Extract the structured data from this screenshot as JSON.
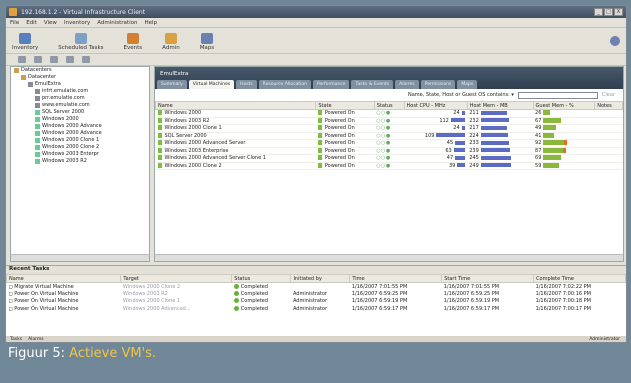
{
  "window": {
    "title": "192.168.1.2 - Virtual Infrastructure Client",
    "buttons": [
      "_",
      "□",
      "X"
    ]
  },
  "menu": [
    "File",
    "Edit",
    "View",
    "Inventory",
    "Administration",
    "Help"
  ],
  "toolbar": {
    "buttons": [
      {
        "label": "Inventory",
        "icon": "inventory-icon",
        "color": "#5a7fbf"
      },
      {
        "label": "Scheduled Tasks",
        "icon": "scheduled-tasks-icon",
        "color": "#7ca0c8"
      },
      {
        "label": "Events",
        "icon": "events-icon",
        "color": "#d08030"
      },
      {
        "label": "Admin",
        "icon": "admin-icon",
        "color": "#d8a040"
      },
      {
        "label": "Maps",
        "icon": "maps-icon",
        "color": "#6a80b0"
      }
    ]
  },
  "tree": [
    {
      "label": "Datacenters",
      "level": 0,
      "kind": "dc"
    },
    {
      "label": "Datacenter",
      "level": 1,
      "kind": "dc"
    },
    {
      "label": "EmulExtra",
      "level": 2,
      "kind": "host"
    },
    {
      "label": "infrt.emulatie.com",
      "level": 3,
      "kind": "host"
    },
    {
      "label": "prr.emulatie.com",
      "level": 3,
      "kind": "host"
    },
    {
      "label": "www.emulatie.com",
      "level": 3,
      "kind": "host"
    },
    {
      "label": "SQL Server 2000",
      "level": 3,
      "kind": "vm"
    },
    {
      "label": "Windows 2000",
      "level": 3,
      "kind": "vm"
    },
    {
      "label": "Windows 2000 Advance",
      "level": 3,
      "kind": "vm"
    },
    {
      "label": "Windows 2000 Advance",
      "level": 3,
      "kind": "vm"
    },
    {
      "label": "Windows 2000 Clone 1",
      "level": 3,
      "kind": "vm"
    },
    {
      "label": "Windows 2000 Clone 2",
      "level": 3,
      "kind": "vm"
    },
    {
      "label": "Windows 2003 Enterpr",
      "level": 3,
      "kind": "vm"
    },
    {
      "label": "Windows 2003 R2",
      "level": 3,
      "kind": "vm"
    }
  ],
  "main": {
    "title": "EmulExtra",
    "tabs": [
      "Summary",
      "Virtual Machines",
      "Hosts",
      "Resource Allocation",
      "Performance",
      "Tasks & Events",
      "Alarms",
      "Permissions",
      "Maps"
    ],
    "active_tab": 1,
    "filter_label": "Name, State, Host or Guest OS contains: ▾",
    "filter_clear": "Clear",
    "columns": [
      "Name",
      "State",
      "Status",
      "Host CPU - MHz",
      "Host Mem - MB",
      "Guest Mem - %",
      "Notes"
    ],
    "rows": [
      {
        "name": "Windows 2000",
        "state": "Powered On",
        "status": "○○●",
        "cpu": "24",
        "cpu_frac": 0.1,
        "mem": "211",
        "mem_frac": 0.72,
        "guest": "26",
        "guest_frac": 0.26
      },
      {
        "name": "Windows 2003 R2",
        "state": "Powered On",
        "status": "○○●",
        "cpu": "112",
        "cpu_frac": 0.4,
        "mem": "232",
        "mem_frac": 0.78,
        "guest": "67",
        "guest_frac": 0.67
      },
      {
        "name": "Windows 2000 Clone 1",
        "state": "Powered On",
        "status": "○○●",
        "cpu": "24",
        "cpu_frac": 0.1,
        "mem": "217",
        "mem_frac": 0.74,
        "guest": "49",
        "guest_frac": 0.49
      },
      {
        "name": "SQL Server 2000",
        "state": "Powered On",
        "status": "○○●",
        "cpu": "109",
        "cpu_frac": 0.8,
        "mem": "224",
        "mem_frac": 0.76,
        "guest": "41",
        "guest_frac": 0.41
      },
      {
        "name": "Windows 2000 Advanced Server",
        "state": "Powered On",
        "status": "○○●",
        "cpu": "45",
        "cpu_frac": 0.28,
        "mem": "233",
        "mem_frac": 0.79,
        "guest": "92",
        "guest_frac": 0.92
      },
      {
        "name": "Windows 2003 Enterprise",
        "state": "Powered On",
        "status": "○○●",
        "cpu": "63",
        "cpu_frac": 0.32,
        "mem": "239",
        "mem_frac": 0.81,
        "guest": "87",
        "guest_frac": 0.87
      },
      {
        "name": "Windows 2000 Advanced Server Clone 1",
        "state": "Powered On",
        "status": "○○●",
        "cpu": "47",
        "cpu_frac": 0.28,
        "mem": "245",
        "mem_frac": 0.83,
        "guest": "69",
        "guest_frac": 0.69
      },
      {
        "name": "Windows 2000 Clone 2",
        "state": "Powered On",
        "status": "○○●",
        "cpu": "39",
        "cpu_frac": 0.22,
        "mem": "249",
        "mem_frac": 0.85,
        "guest": "59",
        "guest_frac": 0.59
      }
    ]
  },
  "recent": {
    "title": "Recent Tasks",
    "columns": [
      "Name",
      "Target",
      "Status",
      "Initiated by",
      "Time",
      "Start Time",
      "Complete Time"
    ],
    "rows": [
      {
        "name": "Migrate Virtual Machine",
        "target": "Windows 2000 Clone 2",
        "status": "Completed",
        "by": "",
        "time": "1/16/2007 7:01:55 PM",
        "start": "1/16/2007 7:01:55 PM",
        "complete": "1/16/2007 7:02:22 PM"
      },
      {
        "name": "Power On Virtual Machine",
        "target": "Windows 2003 R2",
        "status": "Completed",
        "by": "Administrator",
        "time": "1/16/2007 6:59:25 PM",
        "start": "1/16/2007 6:59:25 PM",
        "complete": "1/16/2007 7:00:16 PM"
      },
      {
        "name": "Power On Virtual Machine",
        "target": "Windows 2000 Clone 1",
        "status": "Completed",
        "by": "Administrator",
        "time": "1/16/2007 6:59:19 PM",
        "start": "1/16/2007 6:59:19 PM",
        "complete": "1/16/2007 7:00:18 PM"
      },
      {
        "name": "Power On Virtual Machine",
        "target": "Windows 2000 Advanced...",
        "status": "Completed",
        "by": "Administrator",
        "time": "1/16/2007 6:59:17 PM",
        "start": "1/16/2007 6:59:17 PM",
        "complete": "1/16/2007 7:00:17 PM"
      }
    ]
  },
  "statusbar": {
    "tasks": "Tasks",
    "alarms": "Alarms",
    "user": "Administrator"
  },
  "caption": {
    "prefix": "Figuur 5:",
    "text": "Actieve VM's."
  }
}
